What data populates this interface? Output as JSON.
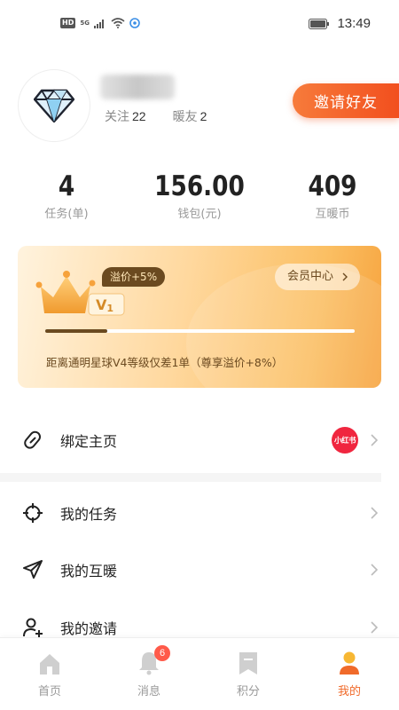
{
  "status_bar": {
    "hd": "HD",
    "network": "5G",
    "time": "13:49"
  },
  "profile": {
    "following_label": "关注",
    "following_count": "22",
    "friends_label": "暖友",
    "friends_count": "2",
    "invite_button": "邀请好友"
  },
  "stats": [
    {
      "value": "4",
      "label": "任务(单)"
    },
    {
      "value": "156.00",
      "label": "钱包(元)"
    },
    {
      "value": "409",
      "label": "互暖币"
    }
  ],
  "member_card": {
    "level": "V",
    "level_num": "1",
    "premium_badge": "溢价+5%",
    "member_center_label": "会员中心",
    "progress_fraction": 0.2,
    "progress_text": "距离通明星球V4等级仅差1单（尊享溢价+8%）"
  },
  "menu": {
    "bind_homepage": "绑定主页",
    "xhs_badge": "小红书",
    "my_tasks": "我的任务",
    "my_huwarm": "我的互暖",
    "my_invites": "我的邀请"
  },
  "tabs": [
    {
      "label": "首页",
      "icon": "home-icon"
    },
    {
      "label": "消息",
      "icon": "bell-icon",
      "badge": "6"
    },
    {
      "label": "积分",
      "icon": "bookmark-icon"
    },
    {
      "label": "我的",
      "icon": "person-icon",
      "active": true
    }
  ],
  "colors": {
    "accent": "#f06a2a",
    "invite_start": "#f77b3b",
    "invite_end": "#f24f1e",
    "card_brown": "#6b4a20",
    "xhs_red": "#f0263f"
  }
}
